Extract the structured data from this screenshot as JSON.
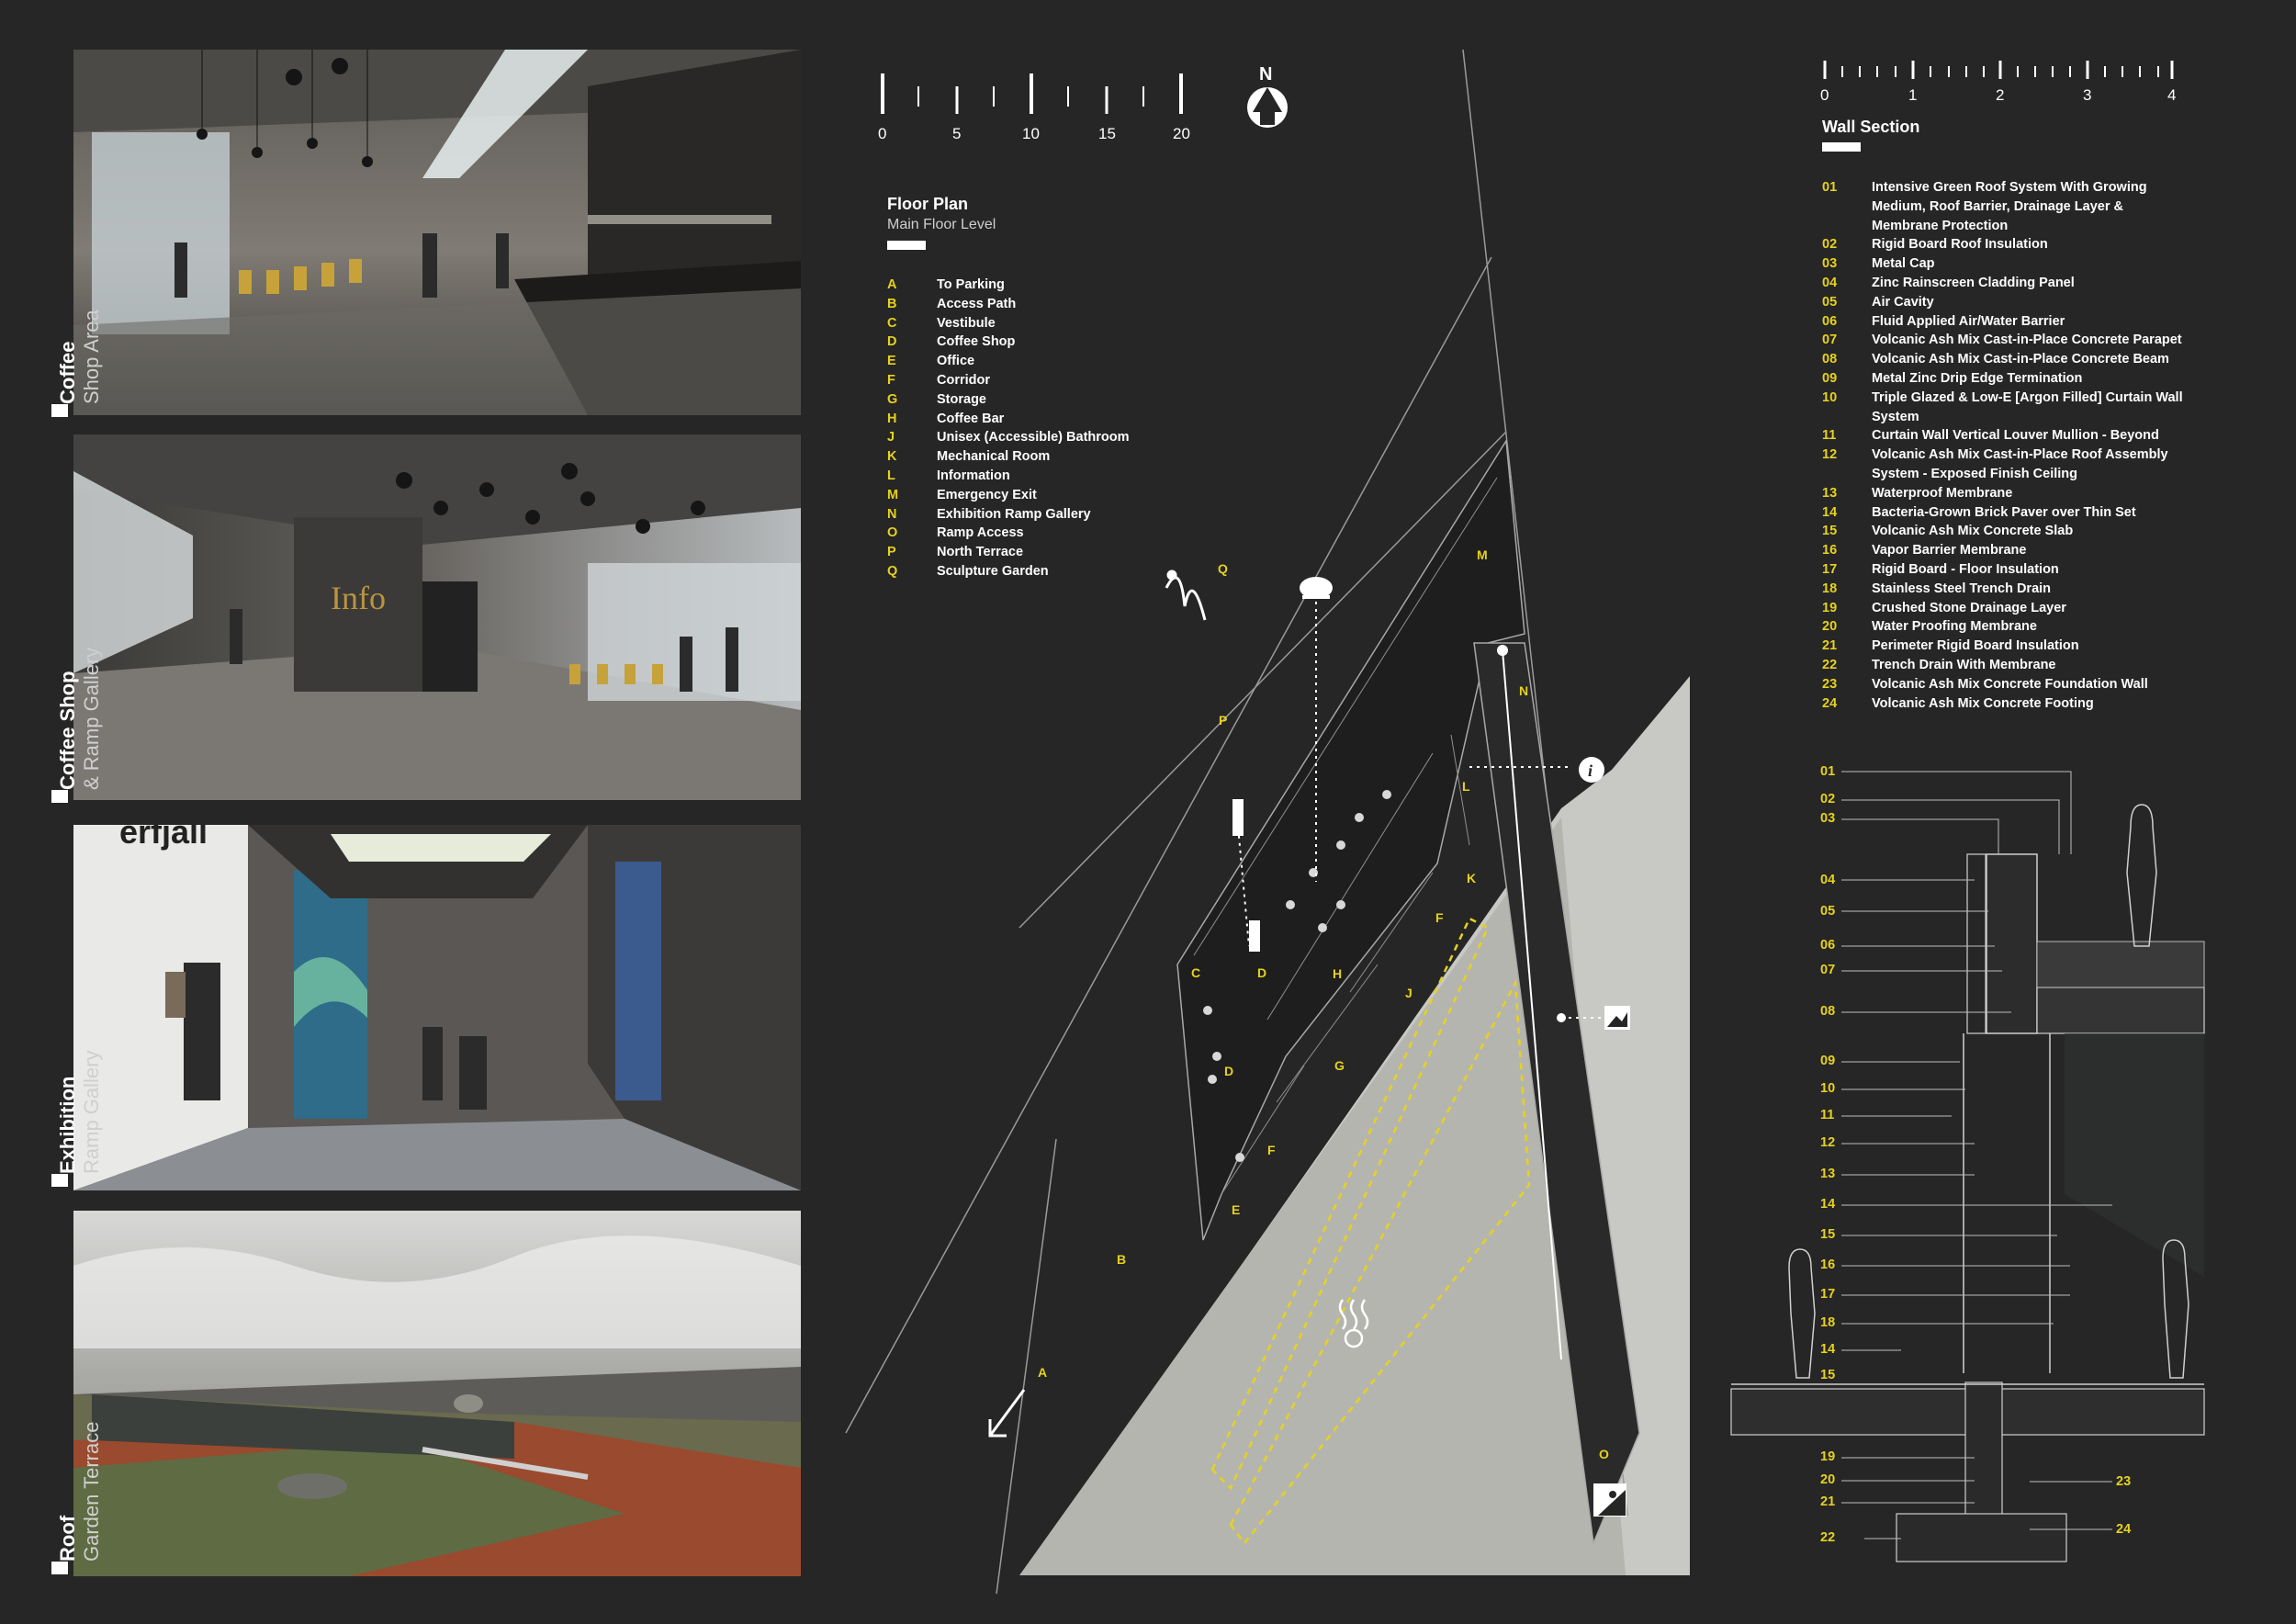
{
  "panels": [
    {
      "title": "Coffee",
      "subtitle": "Shop Area"
    },
    {
      "title": "Coffee Shop",
      "subtitle": "& Ramp Gallery"
    },
    {
      "title": "Exhibition",
      "subtitle": "Ramp Gallery"
    },
    {
      "title": "Roof",
      "subtitle": "Garden Terrace"
    }
  ],
  "render_text": {
    "info_sign": "Info",
    "wall_text": "erfjall"
  },
  "plan_scale": {
    "ticks": [
      "0",
      "5",
      "10",
      "15",
      "20"
    ]
  },
  "north_label": "N",
  "floor_plan": {
    "title": "Floor Plan",
    "subtitle": "Main Floor Level",
    "legend": [
      {
        "key": "A",
        "label": "To Parking"
      },
      {
        "key": "B",
        "label": "Access Path"
      },
      {
        "key": "C",
        "label": "Vestibule"
      },
      {
        "key": "D",
        "label": "Coffee Shop"
      },
      {
        "key": "E",
        "label": "Office"
      },
      {
        "key": "F",
        "label": "Corridor"
      },
      {
        "key": "G",
        "label": "Storage"
      },
      {
        "key": "H",
        "label": "Coffee Bar"
      },
      {
        "key": "J",
        "label": "Unisex (Accessible) Bathroom"
      },
      {
        "key": "K",
        "label": "Mechanical Room"
      },
      {
        "key": "L",
        "label": "Information"
      },
      {
        "key": "M",
        "label": "Emergency Exit"
      },
      {
        "key": "N",
        "label": "Exhibition Ramp Gallery"
      },
      {
        "key": "O",
        "label": "Ramp Access"
      },
      {
        "key": "P",
        "label": "North Terrace"
      },
      {
        "key": "Q",
        "label": "Sculpture Garden"
      }
    ],
    "plan_letters": [
      "Q",
      "M",
      "P",
      "N",
      "L",
      "K",
      "F",
      "J",
      "C",
      "D",
      "H",
      "D",
      "G",
      "F",
      "E",
      "B",
      "A",
      "O"
    ]
  },
  "wall_scale": {
    "ticks": [
      "0",
      "1",
      "2",
      "3",
      "4"
    ]
  },
  "wall_section": {
    "title": "Wall Section",
    "legend": [
      {
        "key": "01",
        "label": "Intensive Green Roof System With Growing Medium, Roof Barrier, Drainage Layer & Membrane Protection"
      },
      {
        "key": "02",
        "label": "Rigid Board Roof Insulation"
      },
      {
        "key": "03",
        "label": "Metal Cap"
      },
      {
        "key": "04",
        "label": "Zinc Rainscreen Cladding Panel"
      },
      {
        "key": "05",
        "label": "Air Cavity"
      },
      {
        "key": "06",
        "label": "Fluid Applied Air/Water Barrier"
      },
      {
        "key": "07",
        "label": "Volcanic Ash Mix Cast-in-Place Concrete Parapet"
      },
      {
        "key": "08",
        "label": "Volcanic Ash Mix Cast-in-Place Concrete Beam"
      },
      {
        "key": "09",
        "label": "Metal Zinc Drip Edge Termination"
      },
      {
        "key": "10",
        "label": "Triple Glazed & Low-E [Argon Filled] Curtain Wall System"
      },
      {
        "key": "11",
        "label": "Curtain Wall Vertical Louver Mullion - Beyond"
      },
      {
        "key": "12",
        "label": "Volcanic Ash Mix Cast-in-Place Roof Assembly System - Exposed Finish Ceiling"
      },
      {
        "key": "13",
        "label": "Waterproof Membrane"
      },
      {
        "key": "14",
        "label": "Bacteria-Grown Brick Paver over Thin Set"
      },
      {
        "key": "15",
        "label": "Volcanic Ash Mix Concrete Slab"
      },
      {
        "key": "16",
        "label": "Vapor Barrier Membrane"
      },
      {
        "key": "17",
        "label": "Rigid Board - Floor Insulation"
      },
      {
        "key": "18",
        "label": "Stainless Steel Trench Drain"
      },
      {
        "key": "19",
        "label": "Crushed Stone Drainage Layer"
      },
      {
        "key": "20",
        "label": "Water Proofing Membrane"
      },
      {
        "key": "21",
        "label": "Perimeter Rigid Board Insulation"
      },
      {
        "key": "22",
        "label": "Trench Drain With Membrane"
      },
      {
        "key": "23",
        "label": "Volcanic Ash Mix Concrete Foundation Wall"
      },
      {
        "key": "24",
        "label": "Volcanic Ash Mix Concrete Footing"
      }
    ],
    "section_callouts_left": [
      "01",
      "02",
      "03",
      "04",
      "05",
      "06",
      "07",
      "08",
      "09",
      "10",
      "11",
      "12",
      "13",
      "14",
      "15",
      "16",
      "17",
      "18",
      "14",
      "15",
      "19",
      "20",
      "21",
      "22"
    ],
    "section_callouts_right": [
      "23",
      "24"
    ]
  }
}
